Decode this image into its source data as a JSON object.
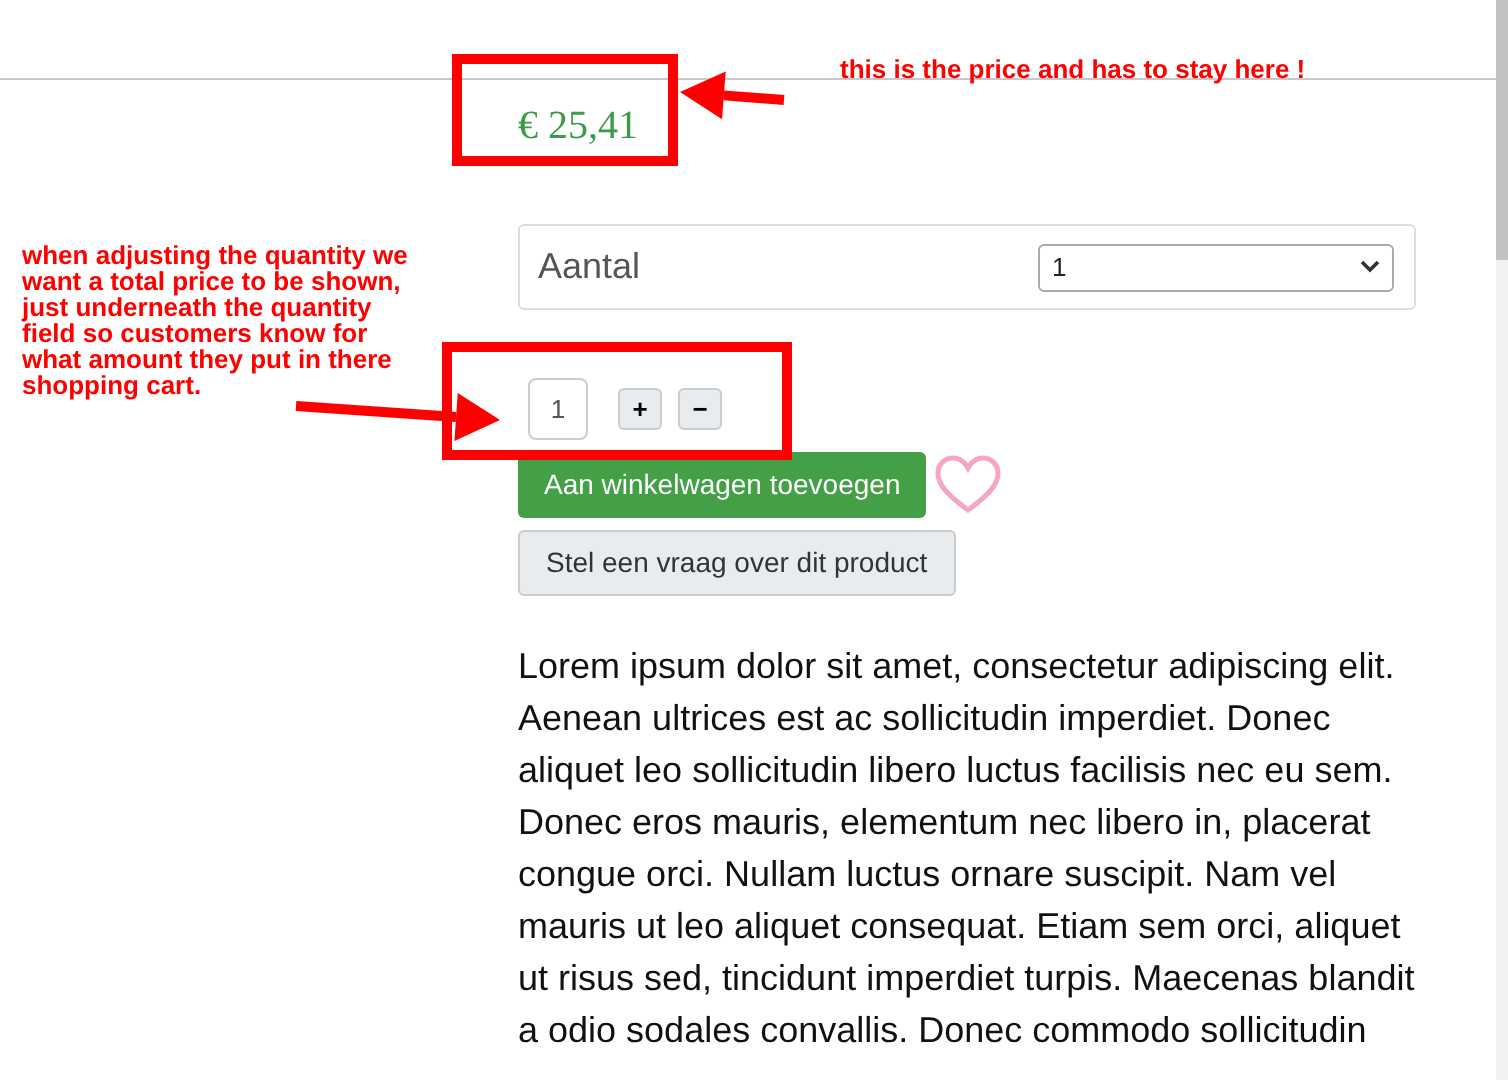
{
  "price": "€ 25,41",
  "quantity_select": {
    "label": "Aantal",
    "value": "1"
  },
  "quantity_stepper": {
    "value": "1",
    "increase": "+",
    "decrease": "−"
  },
  "buttons": [
    {
      "kind": "primary",
      "label": "Aan winkelwagen toevoegen"
    },
    {
      "kind": "secondary",
      "label": "Stel een vraag over dit product"
    }
  ],
  "favorite": {
    "selected": false
  },
  "description": "Lorem ipsum dolor sit amet, consectetur adipiscing elit. Aenean ultrices est ac sollicitudin imperdiet. Donec aliquet leo sollicitudin libero luctus facilisis nec eu sem. Donec eros mauris, elementum nec libero in, placerat congue orci. Nullam luctus ornare suscipit. Nam vel mauris ut leo aliquet consequat. Etiam sem orci, aliquet ut risus sed, tincidunt imperdiet turpis. Maecenas blandit a odio sodales convallis. Donec commodo sollicitudin",
  "annotations": [
    {
      "kind": "price",
      "text": "this is the price and has to stay here !"
    },
    {
      "kind": "quantity",
      "text": "when adjusting the quantity we want a total price to be shown, just underneath the quantity field so customers know for what amount they put in there shopping cart."
    }
  ]
}
